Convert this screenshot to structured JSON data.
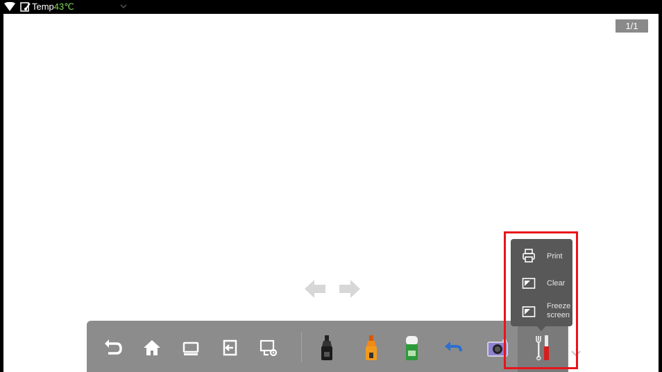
{
  "status_bar": {
    "temp_label": "Temp",
    "temp_value": "43℃",
    "temp_color": "#7ed957"
  },
  "page_counter": "1/1",
  "nav_arrows": [
    "arrow-left-icon",
    "arrow-right-icon"
  ],
  "toolbar": {
    "buttons": [
      {
        "name": "back-button",
        "icon": "undo-arrow-icon"
      },
      {
        "name": "home-button",
        "icon": "home-icon"
      },
      {
        "name": "windows-button",
        "icon": "windows-icon"
      },
      {
        "name": "source-button",
        "icon": "input-source-icon"
      },
      {
        "name": "settings-button",
        "icon": "screen-settings-icon"
      },
      {
        "name": "pen-button",
        "icon": "marker-pen-icon"
      },
      {
        "name": "highlighter-button",
        "icon": "highlighter-icon"
      },
      {
        "name": "eraser-button",
        "icon": "eraser-icon"
      },
      {
        "name": "undo-button",
        "icon": "undo-icon"
      },
      {
        "name": "camera-button",
        "icon": "camera-icon"
      },
      {
        "name": "tools-button",
        "icon": "tools-icon"
      }
    ]
  },
  "tools_menu": {
    "items": [
      {
        "label": "Print",
        "icon": "printer-icon"
      },
      {
        "label": "Clear",
        "icon": "clear-icon"
      },
      {
        "label": "Freeze screen",
        "label_lines": [
          "Freeze",
          "screen"
        ],
        "icon": "freeze-icon"
      }
    ]
  },
  "accent_colors": {
    "highlight": "#e8141c",
    "toolbar": "#8c8c8c",
    "menu": "#585858"
  }
}
